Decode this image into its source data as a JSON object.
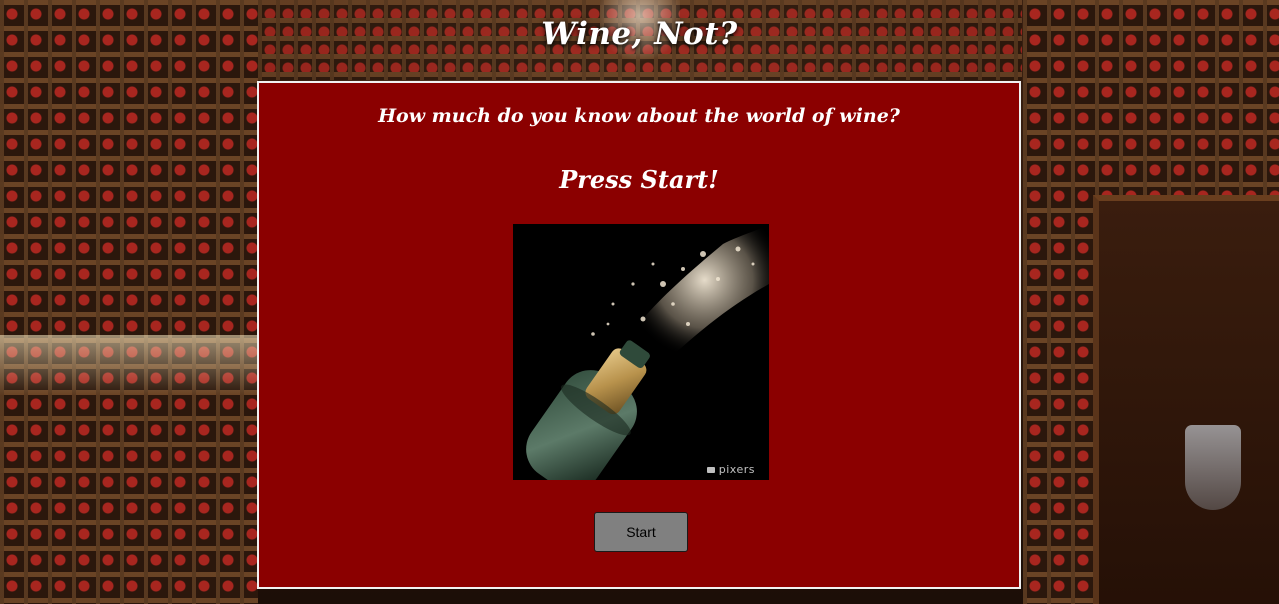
{
  "header": {
    "title": "Wine, Not?"
  },
  "quiz": {
    "question": "How much do you know about the world of wine?",
    "prompt": "Press Start!",
    "image_watermark": "pixers",
    "start_button": "Start"
  },
  "colors": {
    "panel_background": "#8b0000",
    "panel_border": "#f1f1f1",
    "button_background": "#808080",
    "title_text": "#ffffff"
  },
  "icons": {
    "watermark": "camera-icon"
  }
}
